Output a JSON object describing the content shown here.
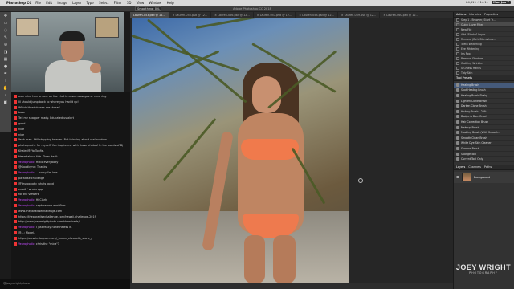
{
  "menubar": {
    "app": "Photoshop CC",
    "items": [
      "File",
      "Edit",
      "Image",
      "Layer",
      "Type",
      "Select",
      "Filter",
      "3D",
      "View",
      "Window",
      "Help"
    ],
    "status": "84,619 ⚡ 14:11",
    "date": "Mon Jan 7"
  },
  "options": {
    "title": "Adobe Photoshop CC 2018",
    "field1": "Smoothing: 0%"
  },
  "doc_tabs": [
    "Lauren-053.psd @ 12...",
    "× Lauren-055.psd @ 12...",
    "× Lauren-056.psd @ 12...",
    "× Lauren-057.psd @ 12...",
    "× Lauren-058.psd @ 12...",
    "× Lauren-059.psd @ 12...",
    "× Lauren-060.psd @ 12..."
  ],
  "chat": {
    "messages": [
      {
        "user": "",
        "text": "was mine turn on any on the chat in case messages or recurring",
        "color": ""
      },
      {
        "user": "",
        "text": "Ill should jump back to where you had it up!",
        "color": ""
      },
      {
        "user": "",
        "text": "Which Headphones are those?",
        "color": ""
      },
      {
        "user": "",
        "text": "bose",
        "color": "red"
      },
      {
        "user": "",
        "text": "Tell my snapper ready. Educated us alert",
        "color": ""
      },
      {
        "user": "",
        "text": "good",
        "color": "red"
      },
      {
        "user": "",
        "text": "nice",
        "color": "red"
      },
      {
        "user": "",
        "text": "nice",
        "color": "red"
      },
      {
        "user": "",
        "text": "Yeah man. Still stepping heaven. But thinking about real outdoor",
        "color": ""
      },
      {
        "user": "",
        "text": "photography for myself. You inspire me with those photos! In the words of Dj",
        "color": ""
      },
      {
        "user": "",
        "text": "Khaled® Yo Tonfie.",
        "color": ""
      },
      {
        "user": "",
        "text": "Heard about this. Does dealt",
        "color": ""
      },
      {
        "user": "Yeurophotic",
        "text": "Hello everybody",
        "color": ""
      },
      {
        "user": "",
        "text": "@Goodbynd: Thanks",
        "color": ""
      },
      {
        "user": "Yeurophotic",
        "text": "... sorry I'm late...",
        "color": ""
      },
      {
        "user": "",
        "text": "paradise challenge",
        "color": ""
      },
      {
        "user": "",
        "text": "@Yeurophotic whats good",
        "color": ""
      },
      {
        "user": "",
        "text": "email / whats app",
        "color": ""
      },
      {
        "user": "",
        "text": "for the viewers",
        "color": ""
      },
      {
        "user": "Yeurophotic",
        "text": "Hi Clark",
        "color": ""
      },
      {
        "user": "Yeurophotic",
        "text": "capture one workflow",
        "color": ""
      },
      {
        "user": "",
        "text": "www.theparadisechallenge.com",
        "color": ""
      },
      {
        "user": "",
        "text": "https://theparadisechallenge.com/hawaii-challenge-2019",
        "color": ""
      },
      {
        "user": "",
        "text": "http://www.joeywrightphoto.com/downloads/",
        "color": ""
      },
      {
        "user": "Yeurophotic",
        "text": "I just really nonetheless it.",
        "color": ""
      },
      {
        "user": "",
        "text": "@...: Model.",
        "color": ""
      },
      {
        "user": "",
        "text": "https://www.instagram.com/_lauren_elizabeth_stone_/",
        "color": ""
      },
      {
        "user": "Yeurophotic",
        "text": "chris the \"mica\"?",
        "color": ""
      }
    ],
    "input_hint": "@joeywrightphoto"
  },
  "history": {
    "tabs": [
      "Actions",
      "Libraries",
      "Properties"
    ],
    "items": [
      "Step 1 - Browser, Start Tr...",
      "Quick Layer Filter",
      "New File",
      "Add \"Stroke\" Layer",
      "Remove (Dehl Blemishes...",
      "Teeth Whitening",
      "Eye Whitening",
      "Iris Pop",
      "Remove Shadows",
      "Clothing Wrinkles",
      "Un-mess Hands",
      "Tidy Skin"
    ]
  },
  "presets": {
    "title": "Tool Presets",
    "items": [
      "Healing Brush",
      "Spot Healing Brush",
      "Healing Brush Shaky",
      "Lighten Clone Brush",
      "Darken Clone Brush",
      "History Brush - 20%",
      "Dodge & Burn Brush",
      "Hair Correction Brush",
      "Makeup Brush",
      "Masking Brush (With Smooth...",
      "Smooth Clean Brush",
      "White Dye Skin Cleaner",
      "Shadow Brush",
      "Sponge Tool",
      "Current Tool Only"
    ]
  },
  "layers": {
    "tabs": [
      "Layers",
      "Channels",
      "Paths"
    ],
    "layer_name": "Background"
  },
  "brand": {
    "name": "JOEY WRIGHT",
    "sub": "PHOTOGRAPHY"
  },
  "colors": {
    "accent": "#455a7a",
    "chat_user": "#c44cff"
  }
}
